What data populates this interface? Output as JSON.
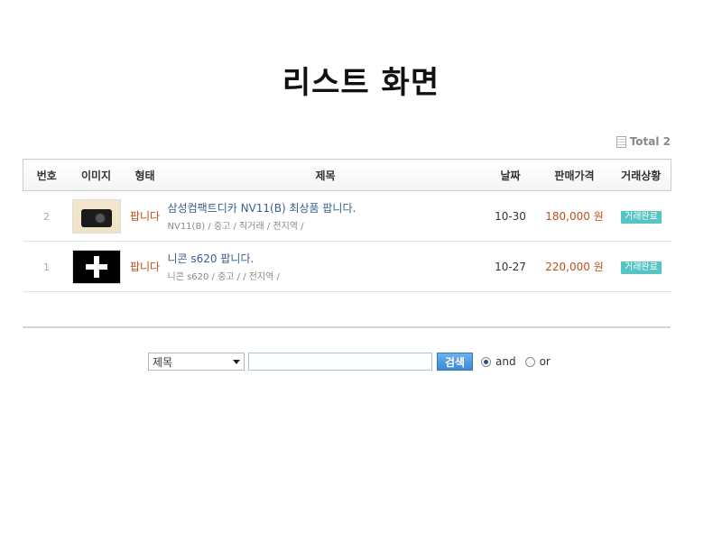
{
  "page": {
    "title": "리스트 화면"
  },
  "total": {
    "label": "Total 2"
  },
  "table": {
    "headers": {
      "num": "번호",
      "image": "이미지",
      "type": "형태",
      "title": "제목",
      "date": "날짜",
      "price": "판매가격",
      "status": "거래상황"
    },
    "rows": [
      {
        "num": "2",
        "image_icon": "camera-thumbnail",
        "type": "팝니다",
        "title": "삼성컴팩트디카 NV11(B) 최상품 팝니다.",
        "meta": "NV11(B) / 중고 / 직거래 / 전지역 /",
        "date": "10-30",
        "price": "180,000 원",
        "status": "거래완료"
      },
      {
        "num": "1",
        "image_icon": "placeholder-thumbnail",
        "type": "팝니다",
        "title": "니콘 s620 팝니다.",
        "meta": "니콘 s620 / 중고 /  / 전지역 /",
        "date": "10-27",
        "price": "220,000 원",
        "status": "거래완료"
      }
    ]
  },
  "search": {
    "field_selected": "제목",
    "input_value": "",
    "button_label": "검색",
    "options": [
      {
        "label": "and",
        "checked": true
      },
      {
        "label": "or",
        "checked": false
      }
    ]
  },
  "colors": {
    "accent_price": "#c0501c",
    "title_link": "#3a5f8f",
    "status_badge": "#55c4c4",
    "search_button": "#3c8ad3"
  }
}
